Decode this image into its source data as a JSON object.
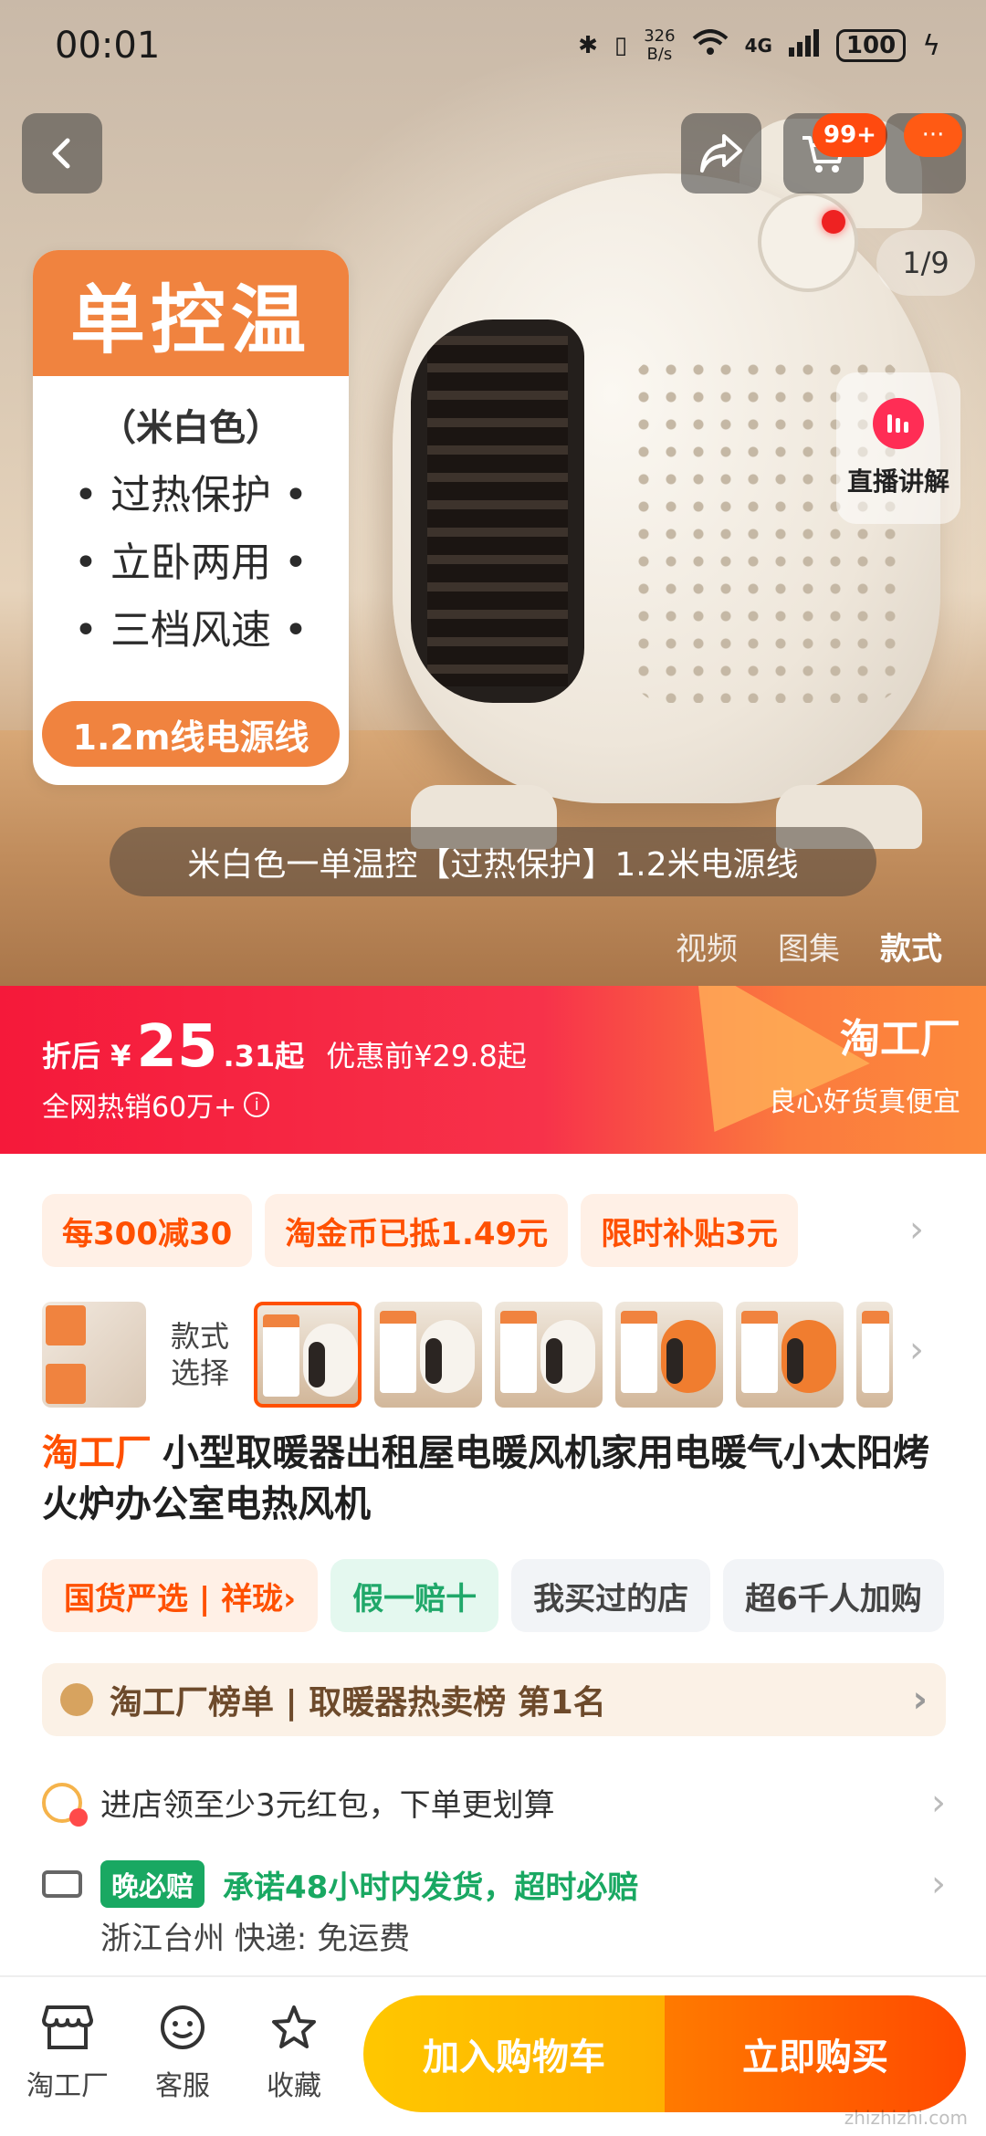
{
  "status_bar": {
    "time": "00:01",
    "net_speed": "326\nB/s",
    "network": "4G",
    "battery": "100"
  },
  "header": {
    "cart_badge": "99+",
    "more_badge": "···",
    "page_counter": "1/9"
  },
  "hero": {
    "feature_title": "单控温",
    "feature_sub": "（米白色）",
    "features": [
      "• 过热保护 •",
      "• 立卧两用 •",
      "• 三档风速 •"
    ],
    "cord_label": "1.2m线电源线",
    "live_label": "直播讲解",
    "caption": "米白色一单温控【过热保护】1.2米电源线",
    "media_tabs": [
      "视频",
      "图集",
      "款式"
    ],
    "active_media_tab": "款式"
  },
  "price": {
    "prefix": "折后 ¥",
    "amount": "25",
    "decimal": ".31起",
    "original": "优惠前¥29.8起",
    "sold": "全网热销60万+",
    "brand": "淘工厂",
    "slogan": "良心好货真便宜"
  },
  "promos": [
    "每300减30",
    "淘金币已抵1.49元",
    "限时补贴3元"
  ],
  "style_selector": {
    "label_line1": "款式",
    "label_line2": "选择",
    "thumb_count": 6,
    "selected_index": 0
  },
  "product": {
    "brand": "淘工厂",
    "title": "小型取暖器出租屋电暖风机家用电暖气小太阳烤火炉办公室电热风机"
  },
  "tags": [
    {
      "label": "国货严选 | 祥珑›",
      "style": "orange"
    },
    {
      "label": "假一赔十",
      "style": "green"
    },
    {
      "label": "我买过的店",
      "style": "gray"
    },
    {
      "label": "超6千人加购",
      "style": "gray"
    }
  ],
  "rank": {
    "text": "淘工厂榜单 | 取暖器热卖榜  第1名"
  },
  "coupon_line": {
    "text": "进店领至少3元红包，下单更划算"
  },
  "delivery": {
    "badge": "晚必赔",
    "promise": "承诺48小时内发货，超时必赔",
    "ship_info": "浙江台州  快递: 免运费"
  },
  "bottom_bar": {
    "shop_label": "淘工厂",
    "service_label": "客服",
    "fav_label": "收藏",
    "add_cart": "加入购物车",
    "buy_now": "立即购买"
  },
  "watermark": "zhizhizhi.com",
  "colors": {
    "accent": "#ff5000",
    "price_red": "#f5193a",
    "feature_orange": "#f0833f",
    "green": "#19a862"
  }
}
